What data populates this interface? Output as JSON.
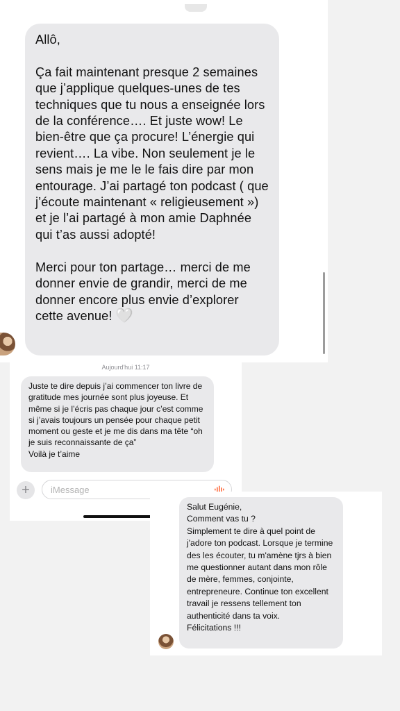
{
  "card1": {
    "message": "Allô,\n\nÇa fait maintenant presque 2 semaines que j’applique quelques-unes de tes techniques que tu nous a enseignée lors de la conférence…. Et juste wow! Le bien-être que ça procure! L’énergie qui revient…. La vibe. Non seulement je le sens mais je me le le fais dire par mon entourage. J’ai partagé ton podcast ( que j’écoute maintenant « religieusement ») et je l’ai partagé à mon amie Daphnée qui t’as aussi adopté!\n\nMerci pour ton partage… merci de me donner envie de grandir, merci de me donner encore plus envie d’explorer cette avenue! ",
    "emoji": "🤍"
  },
  "card2": {
    "timestamp": "Aujourd'hui 11:17",
    "message": "Juste te dire depuis j’ai commencer ton livre de gratitude mes journée sont plus joyeuse. Et même si je l’écris pas chaque jour c’est comme si j’avais toujours un pensée pour chaque petit moment ou geste et je me dis dans ma tête “oh je suis reconnaissante de ça”\nVoilà je t’aime",
    "input_placeholder": "iMessage",
    "plus_label": "+"
  },
  "card3": {
    "message": "Salut Eugénie,\nComment vas tu ?\nSimplement te dire à quel point de j'adore ton podcast. Lorsque je termine des les écouter, tu m'amène tjrs à bien me questionner autant dans mon rôle de mère, femmes, conjointe, entrepreneure. Continue ton excellent travail je ressens tellement ton authenticité dans ta voix.\nFélicitations !!!"
  },
  "colors": {
    "bubble": "#e9e9eb",
    "background": "#f2f2f2",
    "audio_accent": "#ff6a3d"
  },
  "icons": [
    "plus-icon",
    "audio-waveform-icon"
  ]
}
